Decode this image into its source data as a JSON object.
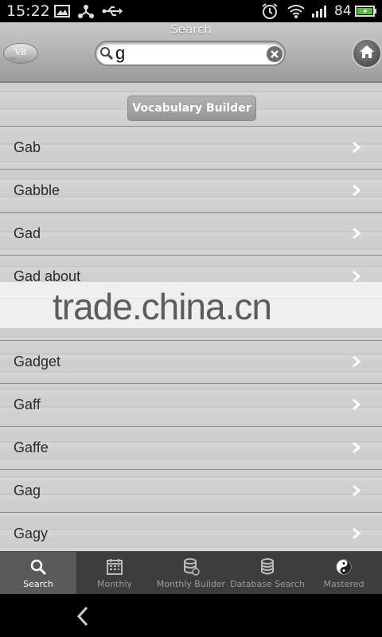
{
  "status_bar": {
    "time": "15:22",
    "battery_percent": "84"
  },
  "header": {
    "title": "Search",
    "logo_text": "VB",
    "search_value": "g"
  },
  "section_button": "Vocabulary Builder",
  "words": [
    "Gab",
    "Gabble",
    "Gad",
    "Gad about",
    "",
    "Gadget",
    "Gaff",
    "Gaffe",
    "Gag",
    "Gagy"
  ],
  "watermark": "trade.china.cn",
  "tabs": [
    {
      "label": "Search",
      "icon": "search-icon",
      "active": true
    },
    {
      "label": "Monthly",
      "icon": "calendar-icon",
      "active": false
    },
    {
      "label": "Monthly Builder",
      "icon": "database-refresh-icon",
      "active": false
    },
    {
      "label": "Database Search",
      "icon": "database-icon",
      "active": false
    },
    {
      "label": "Mastered",
      "icon": "yin-yang-icon",
      "active": false
    }
  ],
  "colors": {
    "header_gray": "#b8b8b8",
    "tab_bar": "#3d3d3d",
    "active_tab": "#5a5a5a"
  }
}
